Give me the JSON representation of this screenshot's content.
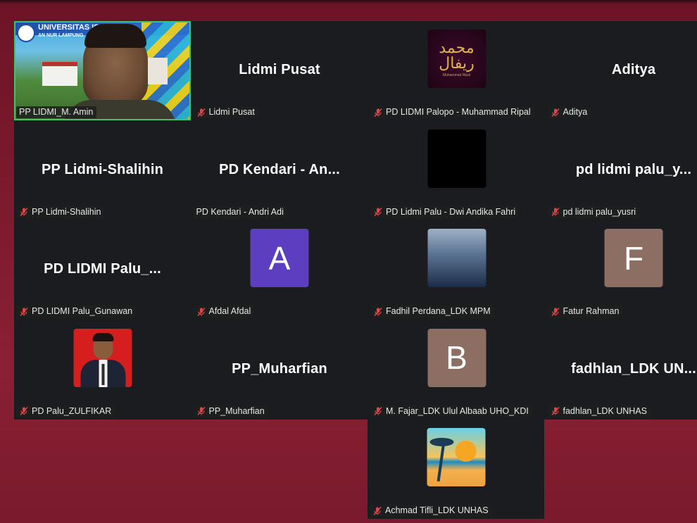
{
  "colors": {
    "tile_bg": "#1a1c1f",
    "active_border": "#3ec46d",
    "mic_muted": "#e0464b"
  },
  "tiles": [
    {
      "display": "",
      "label": "PP LIDMI_M. Amin",
      "type": "video",
      "muted": false,
      "active": true
    },
    {
      "display": "Lidmi Pusat",
      "label": "Lidmi Pusat",
      "type": "name",
      "muted": true
    },
    {
      "display": "",
      "label": "PD LIDMI Palopo - Muhammad Ripal",
      "type": "image-calligraphy",
      "muted": true
    },
    {
      "display": "Aditya",
      "label": "Aditya",
      "type": "name",
      "muted": true
    },
    {
      "display": "PP Lidmi-Shalihin",
      "label": "PP Lidmi-Shalihin",
      "type": "name",
      "muted": true
    },
    {
      "display": "PD Kendari - An...",
      "label": "PD Kendari - Andri Adi",
      "type": "name",
      "muted": false
    },
    {
      "display": "",
      "label": "PD Lidmi Palu - Dwi Andika Fahri",
      "type": "image-black",
      "muted": true
    },
    {
      "display": "pd lidmi palu_y...",
      "label": "pd lidmi palu_yusri",
      "type": "name",
      "muted": true
    },
    {
      "display": "PD LIDMI Palu_...",
      "label": "PD LIDMI Palu_Gunawan",
      "type": "name",
      "muted": true
    },
    {
      "display": "A",
      "label": "Afdal Afdal",
      "type": "letter",
      "color": "#5c3fc0",
      "muted": true
    },
    {
      "display": "",
      "label": "Fadhil Perdana_LDK MPM",
      "type": "image-gradient",
      "muted": true
    },
    {
      "display": "F",
      "label": "Fatur Rahman",
      "type": "letter",
      "color": "#8c6e63",
      "muted": true
    },
    {
      "display": "",
      "label": "PD Palu_ZULFIKAR",
      "type": "image-person",
      "muted": true
    },
    {
      "display": "PP_Muharfian",
      "label": "PP_Muharfian",
      "type": "name",
      "muted": true
    },
    {
      "display": "B",
      "label": "M. Fajar_LDK Ulul Albaab UHO_KDI",
      "type": "letter",
      "color": "#8c6e63",
      "muted": true
    },
    {
      "display": "fadhlan_LDK UN...",
      "label": "fadhlan_LDK UNHAS",
      "type": "name",
      "muted": true
    }
  ],
  "extra_tile": {
    "display": "",
    "label": "Achmad Tifli_LDK UNHAS",
    "type": "image-beach",
    "muted": true
  },
  "video_overlay": {
    "line1": "UNIVERSITAS IS",
    "line2": "AN NUR LAMPUNG"
  },
  "calligraphy_caption": "Muhammad Ripal"
}
